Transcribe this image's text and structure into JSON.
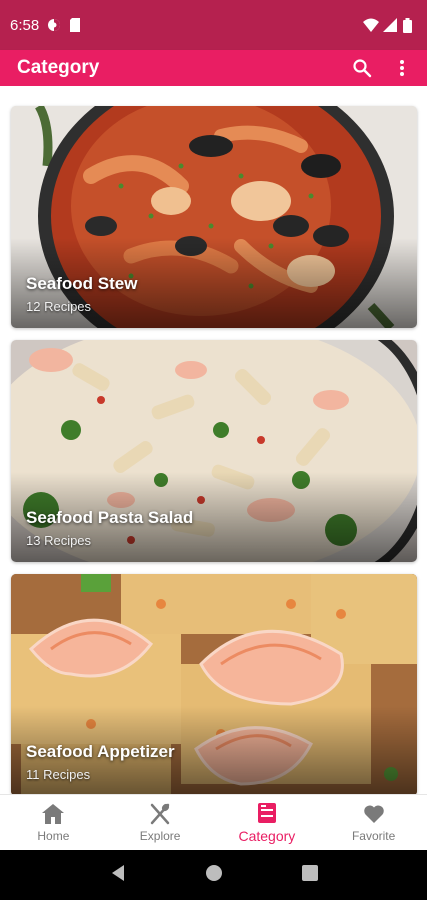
{
  "status_bar": {
    "time": "6:58"
  },
  "app_bar": {
    "title": "Category",
    "search_icon": "search-icon",
    "more_icon": "more-vert-icon"
  },
  "categories": [
    {
      "title": "Seafood Stew",
      "count": "12 Recipes"
    },
    {
      "title": "Seafood Pasta Salad",
      "count": "13 Recipes"
    },
    {
      "title": "Seafood Appetizer",
      "count": "11 Recipes"
    }
  ],
  "bottom_nav": [
    {
      "label": "Home",
      "icon": "home-icon"
    },
    {
      "label": "Explore",
      "icon": "utensils-icon"
    },
    {
      "label": "Category",
      "icon": "category-icon"
    },
    {
      "label": "Favorite",
      "icon": "heart-icon"
    }
  ],
  "colors": {
    "primary": "#e91e63",
    "status_bar": "#b5214f",
    "inactive": "#7a7a7a"
  }
}
